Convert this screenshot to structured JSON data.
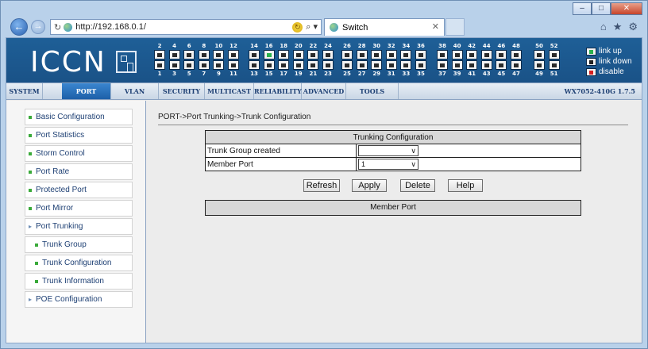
{
  "browser": {
    "url": "http://192.168.0.1/",
    "tab_title": "Switch"
  },
  "banner": {
    "logo_text": "ICCN",
    "port_groups": [
      {
        "top": [
          "2",
          "4",
          "6",
          "8",
          "10",
          "12"
        ],
        "bottom": [
          "1",
          "3",
          "5",
          "7",
          "9",
          "11"
        ]
      },
      {
        "top": [
          "14",
          "16",
          "18",
          "20",
          "22",
          "24"
        ],
        "bottom": [
          "13",
          "15",
          "17",
          "19",
          "21",
          "23"
        ]
      },
      {
        "top": [
          "26",
          "28",
          "30",
          "32",
          "34",
          "36"
        ],
        "bottom": [
          "25",
          "27",
          "29",
          "31",
          "33",
          "35"
        ]
      },
      {
        "top": [
          "38",
          "40",
          "42",
          "44",
          "46",
          "48"
        ],
        "bottom": [
          "37",
          "39",
          "41",
          "43",
          "45",
          "47"
        ]
      },
      {
        "top": [
          "50",
          "52"
        ],
        "bottom": [
          "49",
          "51"
        ]
      }
    ],
    "link_up_ports": [
      "16"
    ],
    "legend": {
      "up": "link up",
      "down": "link down",
      "disable": "disable"
    },
    "colors": {
      "link_up": "#2bb24c",
      "link_down": "#222222",
      "disable": "#d62020",
      "banner": "#1d5a90"
    }
  },
  "menu": {
    "items": [
      "SYSTEM",
      "PORT",
      "VLAN",
      "SECURITY",
      "MULTICAST",
      "RELIABILITY",
      "ADVANCED",
      "TOOLS"
    ],
    "active": "PORT",
    "version": "WX7052-410G 1.7.5"
  },
  "sidebar": {
    "items": [
      {
        "label": "Basic Configuration"
      },
      {
        "label": "Port Statistics"
      },
      {
        "label": "Storm Control"
      },
      {
        "label": "Port Rate"
      },
      {
        "label": "Protected Port"
      },
      {
        "label": "Port Mirror"
      },
      {
        "label": "Port Trunking"
      },
      {
        "label": "Trunk Group"
      },
      {
        "label": "Trunk Configuration"
      },
      {
        "label": "Trunk Information"
      },
      {
        "label": "POE Configuration"
      }
    ]
  },
  "content": {
    "breadcrumb": "PORT->Port Trunking->Trunk Configuration",
    "table_title": "Trunking Configuration",
    "rows": [
      {
        "label": "Trunk Group created",
        "value": ""
      },
      {
        "label": "Member Port",
        "value": "1"
      }
    ],
    "buttons": {
      "refresh": "Refresh",
      "apply": "Apply",
      "delete": "Delete",
      "help": "Help"
    },
    "member_header": "Member Port"
  }
}
